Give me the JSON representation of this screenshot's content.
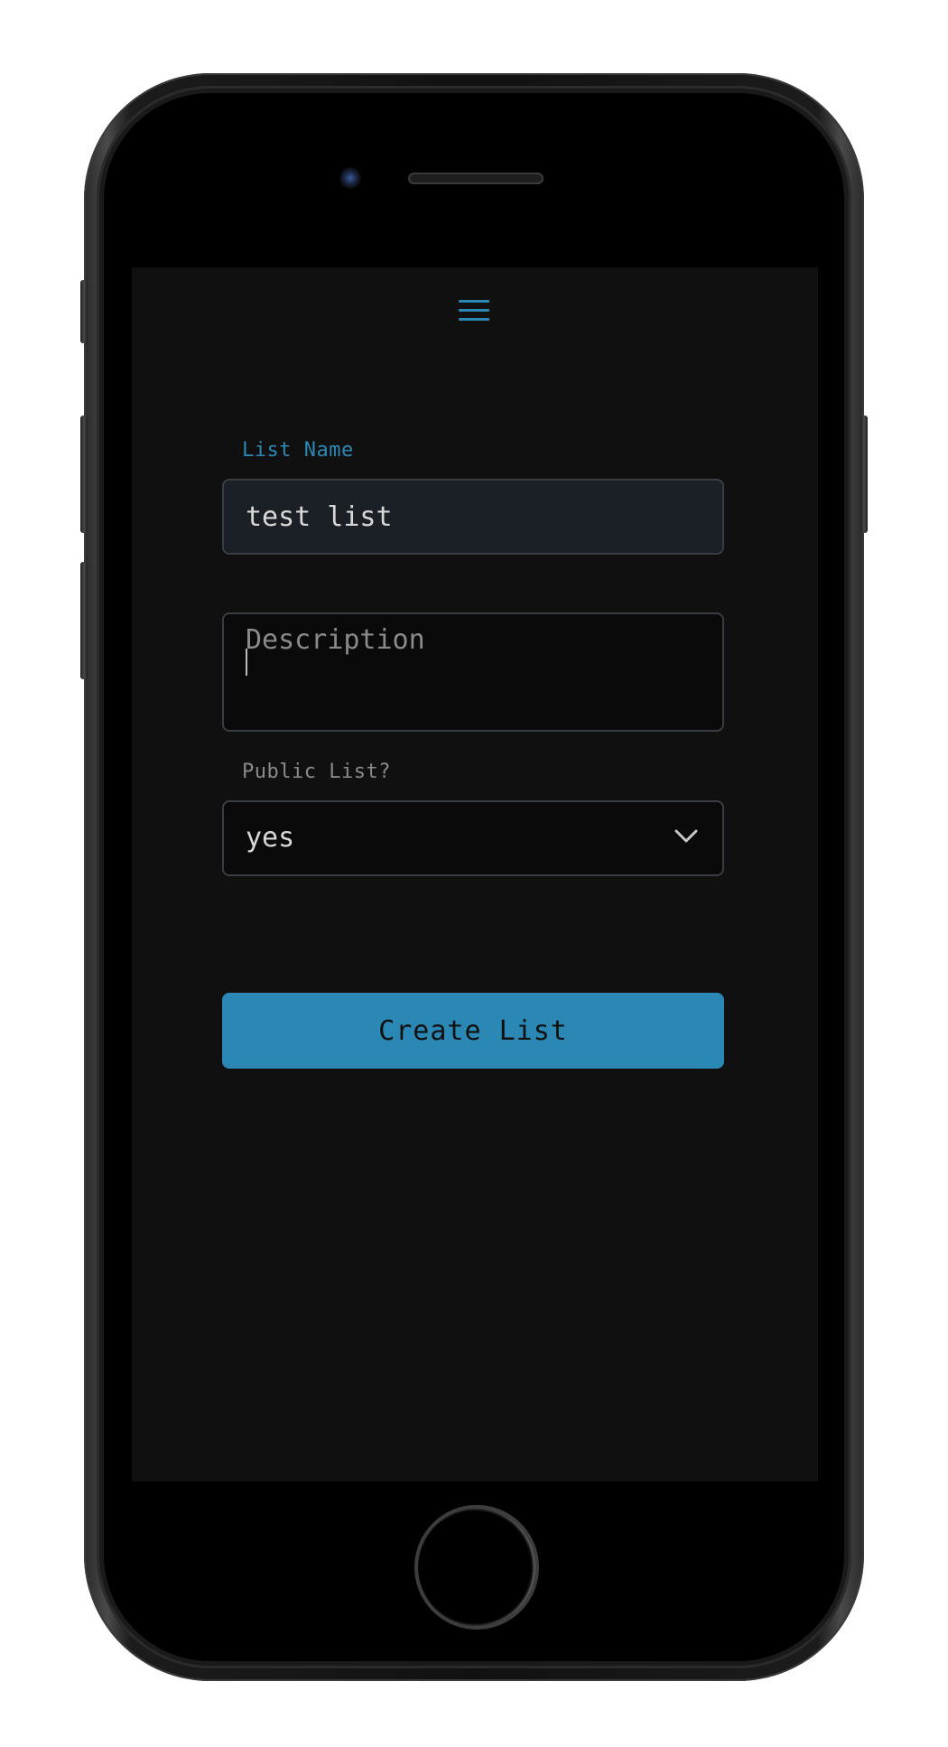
{
  "form": {
    "list_name_label": "List Name",
    "list_name_value": "test list",
    "description_placeholder": "Description",
    "description_value": "",
    "public_label": "Public List?",
    "public_selected": "yes",
    "submit_label": "Create List"
  },
  "icons": {
    "menu": "hamburger-menu-icon",
    "select": "chevron-down-icon"
  },
  "colors": {
    "accent": "#2b88b5",
    "background": "#101010",
    "input_filled_bg": "#1b1f26",
    "input_bg": "#0a0a0b",
    "muted_text": "#8a8a8a"
  }
}
